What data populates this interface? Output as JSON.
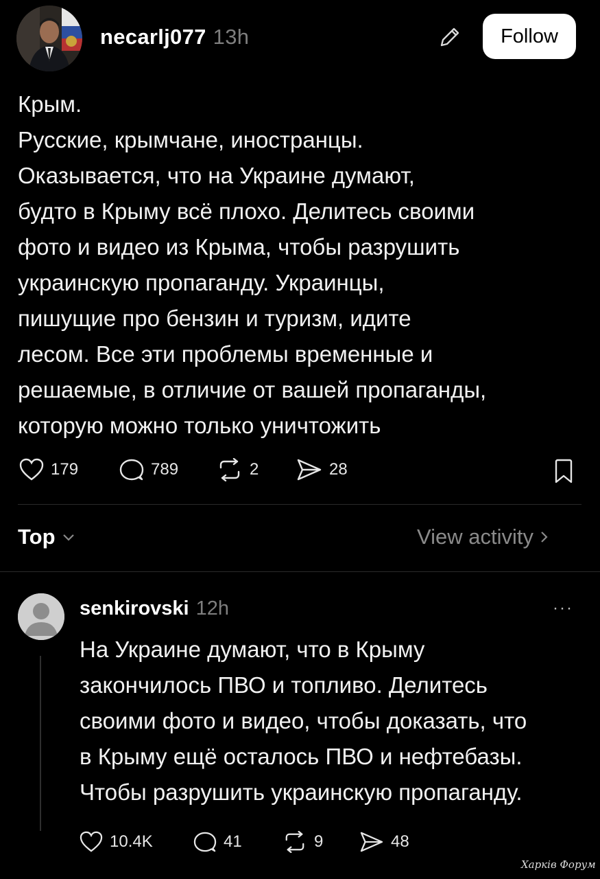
{
  "post": {
    "author": "necarlj077",
    "time": "13h",
    "follow_label": "Follow",
    "lines": [
      "Крым.",
      "Русские, крымчане, иностранцы.",
      "Оказывается, что на Украине думают,",
      "будто в Крыму всё плохо. Делитесь своими",
      "фото и видео из Крыма, чтобы разрушить",
      "украинскую пропаганду. Украинцы,",
      "пишущие про бензин и туризм,  идите",
      "лесом. Все эти проблемы временные и",
      "решаемые, в отличие от вашей пропаганды,",
      "которую можно только уничтожить"
    ],
    "stats": {
      "likes": "179",
      "replies": "789",
      "reposts": "2",
      "shares": "28"
    }
  },
  "sort": {
    "label": "Top",
    "view_activity": "View activity"
  },
  "reply": {
    "author": "senkirovski",
    "time": "12h",
    "more": "···",
    "lines": [
      "На Украине думают, что в Крыму",
      "закончилось ПВО и топливо. Делитесь",
      "своими фото и видео, чтобы доказать, что",
      "в Крыму ещё осталось ПВО и нефтебазы.",
      "Чтобы разрушить украинскую пропаганду."
    ],
    "stats": {
      "likes": "10.4K",
      "replies": "41",
      "reposts": "9",
      "shares": "48"
    }
  },
  "watermark": "Харків Форум",
  "icons": {
    "like": "heart-icon",
    "reply": "comment-icon",
    "repost": "repost-icon",
    "share": "send-icon",
    "save": "bookmark-icon",
    "edit": "pencil-icon"
  }
}
